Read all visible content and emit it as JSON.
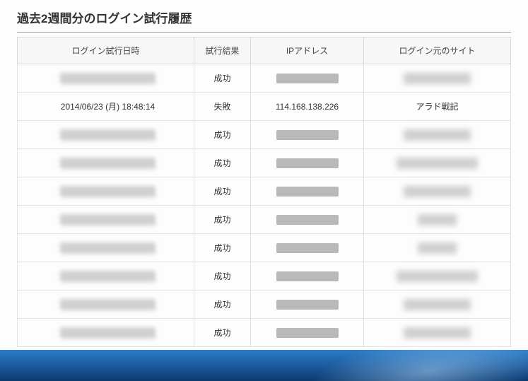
{
  "title": "過去2週間分のログイン試行履歴",
  "headers": {
    "datetime": "ログイン試行日時",
    "result": "試行結果",
    "ip": "IPアドレス",
    "site": "ログイン元のサイト"
  },
  "rows": [
    {
      "datetime_redacted": true,
      "result": "成功",
      "ip_redacted": true,
      "site_redacted": true,
      "site_w": "w1"
    },
    {
      "datetime": "2014/06/23 (月) 18:48:14",
      "result": "失敗",
      "ip": "114.168.138.226",
      "site": "アラド戦記"
    },
    {
      "datetime_redacted": true,
      "result": "成功",
      "ip_redacted": true,
      "site_redacted": true,
      "site_w": "w1"
    },
    {
      "datetime_redacted": true,
      "result": "成功",
      "ip_redacted": true,
      "site_redacted": true,
      "site_w": "w2"
    },
    {
      "datetime_redacted": true,
      "result": "成功",
      "ip_redacted": true,
      "site_redacted": true,
      "site_w": "w1"
    },
    {
      "datetime_redacted": true,
      "result": "成功",
      "ip_redacted": true,
      "site_redacted": true,
      "site_w": "w3"
    },
    {
      "datetime_redacted": true,
      "result": "成功",
      "ip_redacted": true,
      "site_redacted": true,
      "site_w": "w3"
    },
    {
      "datetime_redacted": true,
      "result": "成功",
      "ip_redacted": true,
      "site_redacted": true,
      "site_w": "w2"
    },
    {
      "datetime_redacted": true,
      "result": "成功",
      "ip_redacted": true,
      "site_redacted": true,
      "site_w": "w1"
    },
    {
      "datetime_redacted": true,
      "result": "成功",
      "ip_redacted": true,
      "site_redacted": true,
      "site_w": "w1"
    }
  ]
}
